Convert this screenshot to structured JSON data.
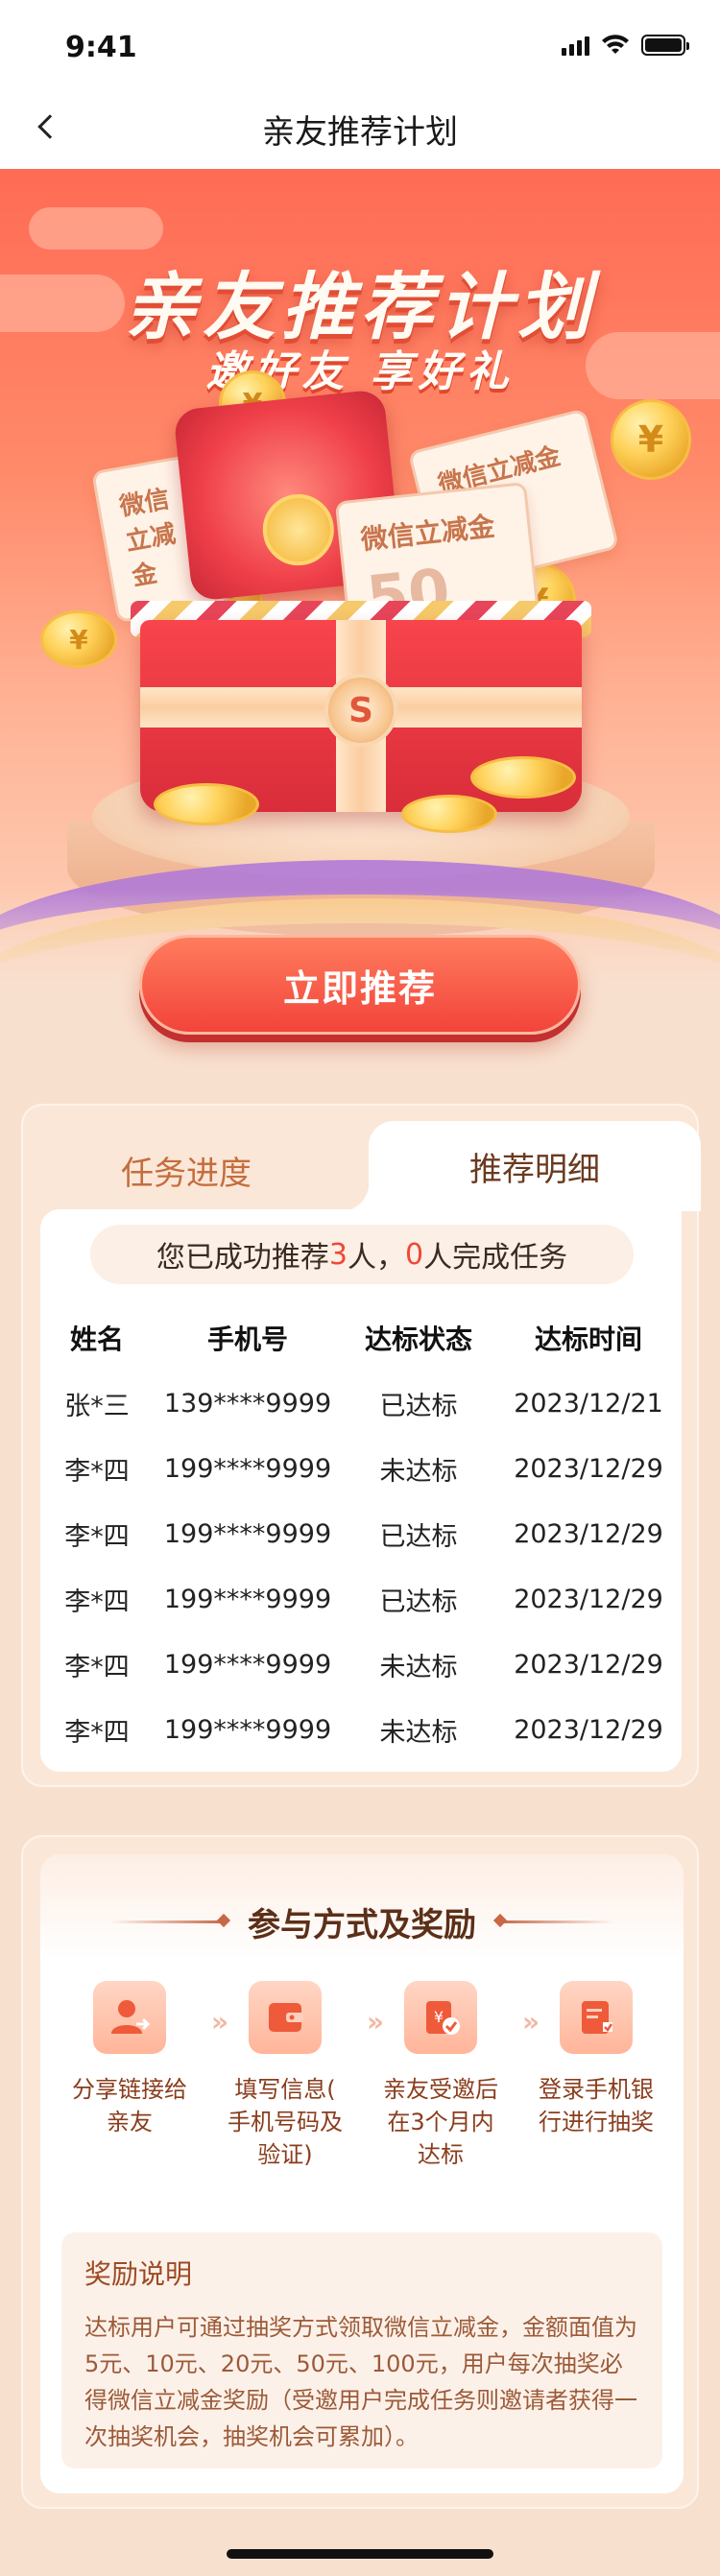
{
  "status_bar": {
    "time": "9:41"
  },
  "nav": {
    "title": "亲友推荐计划"
  },
  "hero": {
    "title": "亲友推荐计划",
    "subtitle": "邀好友 享好礼",
    "voucher_label": "微信立减金",
    "voucher_amount": "50",
    "coin_symbol": "¥",
    "badge_symbol": "S",
    "cta_label": "立即推荐"
  },
  "tabs": [
    {
      "label": "任务进度",
      "active": false
    },
    {
      "label": "推荐明细",
      "active": true
    }
  ],
  "summary": {
    "prefix": "您已成功推荐",
    "recommended": "3",
    "mid": "人，",
    "completed": "0",
    "suffix": "人完成任务"
  },
  "table": {
    "headers": [
      "姓名",
      "手机号",
      "达标状态",
      "达标时间"
    ],
    "rows": [
      {
        "name": "张*三",
        "phone": "139****9999",
        "status": "已达标",
        "time": "2023/12/21"
      },
      {
        "name": "李*四",
        "phone": "199****9999",
        "status": "未达标",
        "time": "2023/12/29"
      },
      {
        "name": "李*四",
        "phone": "199****9999",
        "status": "已达标",
        "time": "2023/12/29"
      },
      {
        "name": "李*四",
        "phone": "199****9999",
        "status": "已达标",
        "time": "2023/12/29"
      },
      {
        "name": "李*四",
        "phone": "199****9999",
        "status": "未达标",
        "time": "2023/12/29"
      },
      {
        "name": "李*四",
        "phone": "199****9999",
        "status": "未达标",
        "time": "2023/12/29"
      }
    ]
  },
  "rules": {
    "title": "参与方式及奖励",
    "steps": [
      {
        "icon": "user-share-icon",
        "lines": [
          "分享链接给",
          "亲友"
        ]
      },
      {
        "icon": "wallet-icon",
        "lines": [
          "填写信息(",
          "手机号码及",
          "验证)"
        ]
      },
      {
        "icon": "coupon-check-icon",
        "lines": [
          "亲友受邀后",
          "在3个月内",
          "达标"
        ]
      },
      {
        "icon": "bank-login-icon",
        "lines": [
          "登录手机银",
          "行进行抽奖"
        ]
      }
    ],
    "arrow": "»",
    "reward_title": "奖励说明",
    "reward_desc": "达标用户可通过抽奖方式领取微信立减金，金额面值为5元、10元、20元、50元、100元，用户每次抽奖必得微信立减金奖励（受邀用户完成任务则邀请者获得一次抽奖机会，抽奖机会可累加）。"
  },
  "colors": {
    "accent": "#f2443a",
    "highlight_number": "#ef4836",
    "page_background": "#f8e0cf",
    "tab_inactive": "#c46d3d"
  }
}
